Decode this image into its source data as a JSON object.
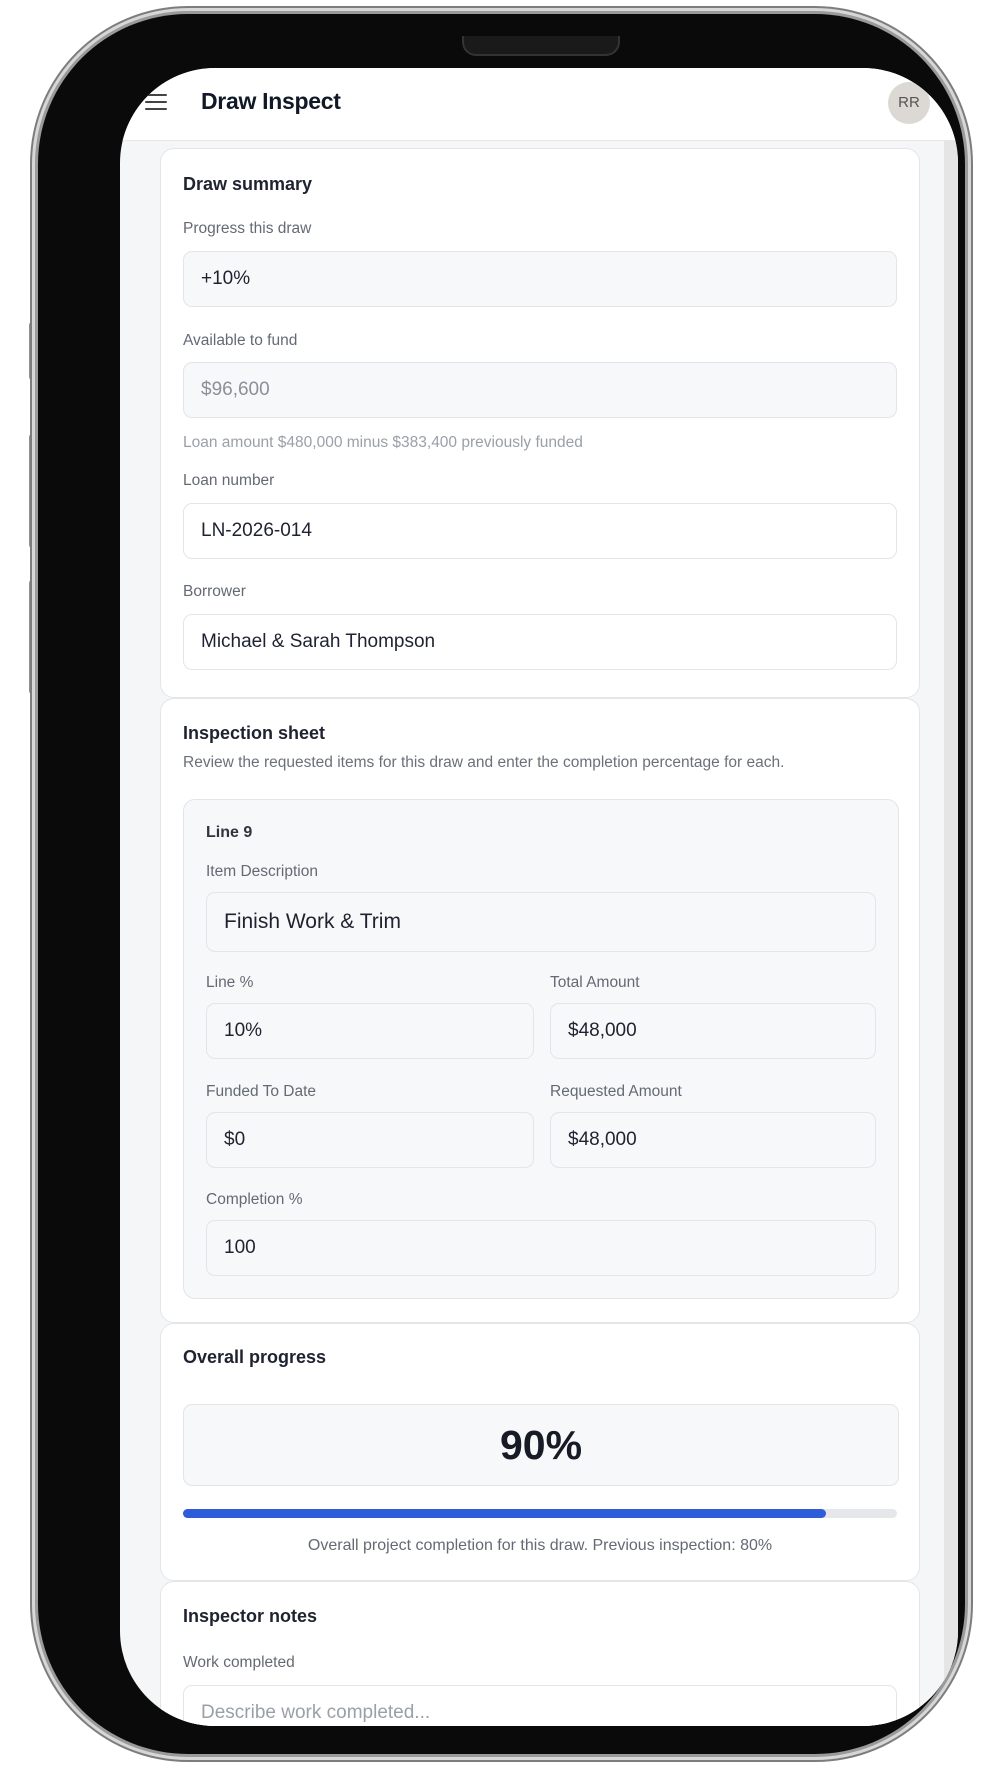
{
  "app": {
    "title": "Draw Inspect",
    "avatar_initials": "RR"
  },
  "draw_summary": {
    "title": "Draw summary",
    "progress_label": "Progress this draw",
    "progress_value": "+10%",
    "available_label": "Available to fund",
    "available_value": "$96,600",
    "available_hint": "Loan amount $480,000 minus $383,400 previously funded",
    "loan_number_label": "Loan number",
    "loan_number_value": "LN-2026-014",
    "borrower_label": "Borrower",
    "borrower_value": "Michael & Sarah Thompson"
  },
  "inspection": {
    "title": "Inspection sheet",
    "description": "Review the requested items for this draw and enter the completion percentage for each.",
    "line": {
      "title": "Line 9",
      "item_description_label": "Item Description",
      "item_description_value": "Finish Work & Trim",
      "line_pct_label": "Line %",
      "line_pct_value": "10%",
      "total_amount_label": "Total Amount",
      "total_amount_value": "$48,000",
      "funded_label": "Funded To Date",
      "funded_value": "$0",
      "requested_label": "Requested Amount",
      "requested_value": "$48,000",
      "completion_label": "Completion %",
      "completion_value": "100"
    }
  },
  "overall": {
    "title": "Overall progress",
    "percent_text": "90%",
    "percent": 90,
    "caption": "Overall project completion for this draw. Previous inspection: 80%",
    "bar_color": "#2f5cd8"
  },
  "notes": {
    "title": "Inspector notes",
    "work_completed_label": "Work completed",
    "work_completed_placeholder": "Describe work completed..."
  }
}
